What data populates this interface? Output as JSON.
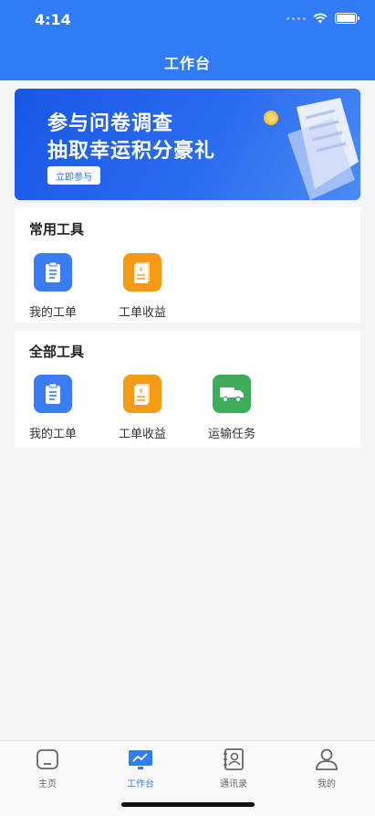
{
  "status": {
    "time": "4:14"
  },
  "nav": {
    "title": "工作台"
  },
  "banner": {
    "line1": "参与问卷调查",
    "line2": "抽取幸运积分豪礼",
    "button": "立即参与"
  },
  "common_tools": {
    "title": "常用工具",
    "items": [
      {
        "label": "我的工单",
        "icon": "clipboard-icon",
        "color": "#3a7cf2"
      },
      {
        "label": "工单收益",
        "icon": "receipt-icon",
        "color": "#f59a14"
      }
    ]
  },
  "all_tools": {
    "title": "全部工具",
    "items": [
      {
        "label": "我的工单",
        "icon": "clipboard-icon",
        "color": "#3a7cf2"
      },
      {
        "label": "工单收益",
        "icon": "receipt-icon",
        "color": "#f59a14"
      },
      {
        "label": "运输任务",
        "icon": "truck-icon",
        "color": "#3cae5a"
      }
    ]
  },
  "tabbar": {
    "items": [
      {
        "label": "主页",
        "icon": "home-icon",
        "active": false
      },
      {
        "label": "工作台",
        "icon": "workbench-icon",
        "active": true
      },
      {
        "label": "通讯录",
        "icon": "contacts-icon",
        "active": false
      },
      {
        "label": "我的",
        "icon": "profile-icon",
        "active": false
      }
    ]
  },
  "colors": {
    "primary": "#2f7cf6",
    "orange": "#f59a14",
    "green": "#3cae5a"
  }
}
